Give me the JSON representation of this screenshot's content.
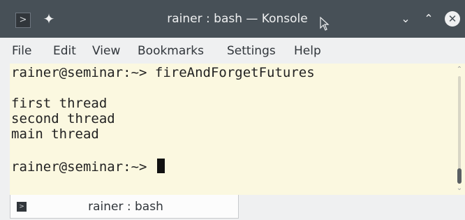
{
  "window": {
    "title": "rainer : bash — Konsole",
    "app_icon": ">",
    "pin_icon": "✦",
    "minimize_glyph": "⌄",
    "maximize_glyph": "⌃",
    "close_glyph": "✕"
  },
  "menu": {
    "items": [
      {
        "label": "File"
      },
      {
        "label": "Edit"
      },
      {
        "label": "View"
      },
      {
        "label": "Bookmarks"
      },
      {
        "label": "Settings"
      },
      {
        "label": "Help"
      }
    ]
  },
  "terminal": {
    "lines": [
      "rainer@seminar:~> fireAndForgetFutures",
      "",
      "first thread",
      "second thread",
      "main thread",
      "",
      "rainer@seminar:~> "
    ]
  },
  "scrollbar": {
    "up_glyph": "⌃",
    "down_glyph": "⌄"
  },
  "tabs": [
    {
      "label": "rainer : bash",
      "icon": ">"
    }
  ],
  "colors": {
    "titlebar": "#475057",
    "terminal_bg": "#fbf8e0",
    "text": "#222222"
  }
}
